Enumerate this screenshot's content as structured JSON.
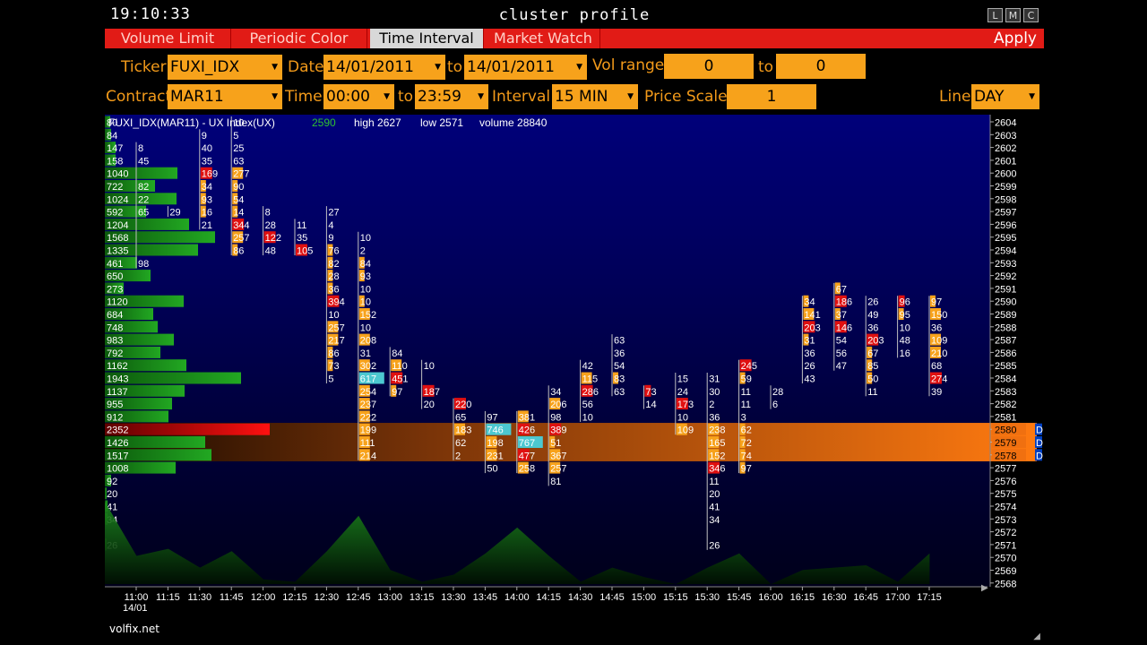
{
  "window": {
    "clock": "19:10:33",
    "title": "cluster profile",
    "buttons": [
      "L",
      "M",
      "C"
    ]
  },
  "tabs": [
    {
      "label": "Volume Limit"
    },
    {
      "label": "Periodic Color"
    },
    {
      "label": "Time Interval"
    },
    {
      "label": "Market Watch"
    }
  ],
  "apply_label": "Apply",
  "controls": {
    "ticker_label": "Ticker",
    "ticker_value": "FUXI_IDX",
    "date_label": "Date",
    "date_from": "14/01/2011",
    "to_label": "to",
    "date_to": "14/01/2011",
    "vol_range_label": "Vol range",
    "vol_from": "0",
    "vol_to_label": "to",
    "vol_to": "0",
    "contract_label": "Contract",
    "contract_value": "MAR11",
    "time_label": "Time",
    "time_from": "00:00",
    "time_to_label": "to",
    "time_to": "23:59",
    "interval_label": "Interval",
    "interval_value": "15 MIN",
    "price_scale_label": "Price Scale",
    "price_scale_value": "1",
    "line_label": "Line",
    "line_value": "DAY"
  },
  "header_info": {
    "name": "FUXI_IDX(MAR11) - UX Index(UX)",
    "last": "2590",
    "high": "high 2627",
    "low": "low 2571",
    "volume": "volume 28840"
  },
  "colors": {
    "bg_top": "#000080",
    "bg_bottom": "#000018",
    "accent_orange": "#f7a21b",
    "tab_red": "#e11b16",
    "profile_green": "#1c8a1c",
    "poc_red": "#e01010",
    "highlight_cyan": "#4cc8d0",
    "value_band": "#f07010"
  },
  "chart_data": {
    "type": "table",
    "price_axis": {
      "min": 2568,
      "max": 2604,
      "step": 1,
      "highlight": [
        2578,
        2579,
        2580
      ]
    },
    "time_labels": [
      "11:00",
      "11:15",
      "11:30",
      "11:45",
      "12:00",
      "12:15",
      "12:30",
      "12:45",
      "13:00",
      "13:15",
      "13:30",
      "13:45",
      "14:00",
      "14:15",
      "14:30",
      "14:45",
      "15:00",
      "15:15",
      "15:30",
      "15:45",
      "16:00",
      "16:15",
      "16:30",
      "16:45",
      "17:00",
      "17:15"
    ],
    "date_label": "14/01",
    "day_profile": [
      {
        "p": 2604,
        "v": "80"
      },
      {
        "p": 2603,
        "v": "84"
      },
      {
        "p": 2602,
        "v": "147"
      },
      {
        "p": 2601,
        "v": "158"
      },
      {
        "p": 2600,
        "v": "1040"
      },
      {
        "p": 2599,
        "v": "722"
      },
      {
        "p": 2598,
        "v": "1024"
      },
      {
        "p": 2597,
        "v": "592"
      },
      {
        "p": 2596,
        "v": "1204"
      },
      {
        "p": 2595,
        "v": "1568"
      },
      {
        "p": 2594,
        "v": "1335"
      },
      {
        "p": 2593,
        "v": "461"
      },
      {
        "p": 2592,
        "v": "650"
      },
      {
        "p": 2591,
        "v": "273"
      },
      {
        "p": 2590,
        "v": "1120"
      },
      {
        "p": 2589,
        "v": "684"
      },
      {
        "p": 2588,
        "v": "748"
      },
      {
        "p": 2587,
        "v": "983"
      },
      {
        "p": 2586,
        "v": "792"
      },
      {
        "p": 2585,
        "v": "1162"
      },
      {
        "p": 2584,
        "v": "1943"
      },
      {
        "p": 2583,
        "v": "1137"
      },
      {
        "p": 2582,
        "v": "955"
      },
      {
        "p": 2581,
        "v": "912"
      },
      {
        "p": 2580,
        "v": "2352"
      },
      {
        "p": 2579,
        "v": "1426"
      },
      {
        "p": 2578,
        "v": "1517"
      },
      {
        "p": 2577,
        "v": "1008"
      },
      {
        "p": 2576,
        "v": "92"
      },
      {
        "p": 2575,
        "v": "20"
      },
      {
        "p": 2574,
        "v": "41"
      },
      {
        "p": 2573,
        "v": "34"
      },
      {
        "p": 2571,
        "v": "26"
      }
    ],
    "clusters": [
      {
        "t": 0,
        "cells": [
          [
            2602,
            "8",
            ""
          ],
          [
            2601,
            "45",
            ""
          ],
          [
            2599,
            "82",
            ""
          ],
          [
            2598,
            "22",
            ""
          ],
          [
            2597,
            "65",
            ""
          ],
          [
            2596,
            "",
            ""
          ],
          [
            2593,
            "98",
            ""
          ]
        ]
      },
      {
        "t": 1,
        "cells": [
          [
            2597,
            "29",
            ""
          ]
        ]
      },
      {
        "t": 2,
        "cells": [
          [
            2603,
            "9",
            ""
          ],
          [
            2602,
            "40",
            ""
          ],
          [
            2601,
            "35",
            ""
          ],
          [
            2600,
            "169",
            "r"
          ],
          [
            2599,
            "34",
            "o"
          ],
          [
            2598,
            "93",
            "o"
          ],
          [
            2597,
            "16",
            "o"
          ],
          [
            2596,
            "21",
            ""
          ]
        ]
      },
      {
        "t": 3,
        "cells": [
          [
            2604,
            "10",
            ""
          ],
          [
            2603,
            "5",
            ""
          ],
          [
            2602,
            "25",
            ""
          ],
          [
            2601,
            "63",
            ""
          ],
          [
            2600,
            "277",
            "o"
          ],
          [
            2599,
            "90",
            "o"
          ],
          [
            2598,
            "54",
            "o"
          ],
          [
            2597,
            "14",
            "o"
          ],
          [
            2596,
            "344",
            "r"
          ],
          [
            2595,
            "257",
            "o"
          ],
          [
            2594,
            "86",
            "o"
          ]
        ]
      },
      {
        "t": 4,
        "cells": [
          [
            2597,
            "8",
            ""
          ],
          [
            2596,
            "28",
            ""
          ],
          [
            2595,
            "122",
            "r"
          ],
          [
            2594,
            "48",
            ""
          ]
        ]
      },
      {
        "t": 5,
        "cells": [
          [
            2596,
            "11",
            ""
          ],
          [
            2595,
            "35",
            ""
          ],
          [
            2594,
            "105",
            "r"
          ]
        ]
      },
      {
        "t": 6,
        "cells": [
          [
            2597,
            "27",
            ""
          ],
          [
            2596,
            "4",
            ""
          ],
          [
            2595,
            "9",
            ""
          ],
          [
            2594,
            "76",
            "o"
          ],
          [
            2593,
            "82",
            "o"
          ],
          [
            2592,
            "28",
            "o"
          ],
          [
            2591,
            "36",
            "o"
          ],
          [
            2590,
            "394",
            "r"
          ],
          [
            2589,
            "10",
            ""
          ],
          [
            2588,
            "257",
            "o"
          ],
          [
            2587,
            "217",
            "o"
          ],
          [
            2586,
            "86",
            "o"
          ],
          [
            2585,
            "73",
            "o"
          ],
          [
            2584,
            "5",
            ""
          ]
        ]
      },
      {
        "t": 7,
        "cells": [
          [
            2595,
            "10",
            ""
          ],
          [
            2594,
            "2",
            ""
          ],
          [
            2593,
            "84",
            "o"
          ],
          [
            2592,
            "93",
            "o"
          ],
          [
            2591,
            "10",
            ""
          ],
          [
            2590,
            "10",
            "o"
          ],
          [
            2589,
            "152",
            "o"
          ],
          [
            2588,
            "10",
            ""
          ],
          [
            2587,
            "208",
            "o"
          ],
          [
            2586,
            "31",
            ""
          ],
          [
            2585,
            "302",
            "o"
          ],
          [
            2584,
            "617",
            "c"
          ],
          [
            2583,
            "254",
            "o"
          ],
          [
            2582,
            "237",
            "o"
          ],
          [
            2581,
            "222",
            "o"
          ],
          [
            2580,
            "199",
            "o"
          ],
          [
            2579,
            "111",
            "o"
          ],
          [
            2578,
            "214",
            "o"
          ]
        ]
      },
      {
        "t": 8,
        "cells": [
          [
            2586,
            "84",
            ""
          ],
          [
            2585,
            "110",
            "o"
          ],
          [
            2584,
            "451",
            "r"
          ],
          [
            2583,
            "97",
            "o"
          ]
        ]
      },
      {
        "t": 9,
        "cells": [
          [
            2585,
            "10",
            ""
          ],
          [
            2583,
            "187",
            "r"
          ],
          [
            2582,
            "20",
            ""
          ]
        ]
      },
      {
        "t": 10,
        "cells": [
          [
            2582,
            "220",
            "r"
          ],
          [
            2581,
            "65",
            ""
          ],
          [
            2580,
            "183",
            "o"
          ],
          [
            2579,
            "62",
            ""
          ],
          [
            2578,
            "2",
            ""
          ]
        ]
      },
      {
        "t": 11,
        "cells": [
          [
            2581,
            "97",
            ""
          ],
          [
            2580,
            "746",
            "c"
          ],
          [
            2579,
            "198",
            "o"
          ],
          [
            2578,
            "231",
            "o"
          ],
          [
            2577,
            "50",
            ""
          ]
        ]
      },
      {
        "t": 12,
        "cells": [
          [
            2581,
            "381",
            "o"
          ],
          [
            2580,
            "426",
            "r"
          ],
          [
            2579,
            "767",
            "c"
          ],
          [
            2578,
            "477",
            "r"
          ],
          [
            2577,
            "258",
            "o"
          ]
        ]
      },
      {
        "t": 13,
        "cells": [
          [
            2583,
            "34",
            ""
          ],
          [
            2582,
            "206",
            "o"
          ],
          [
            2581,
            "98",
            ""
          ],
          [
            2580,
            "389",
            "r"
          ],
          [
            2579,
            "51",
            "o"
          ],
          [
            2578,
            "367",
            "o"
          ],
          [
            2577,
            "257",
            "o"
          ],
          [
            2576,
            "81",
            ""
          ]
        ]
      },
      {
        "t": 14,
        "cells": [
          [
            2585,
            "42",
            ""
          ],
          [
            2584,
            "115",
            "o"
          ],
          [
            2583,
            "286",
            "r"
          ],
          [
            2582,
            "56",
            ""
          ],
          [
            2581,
            "10",
            ""
          ]
        ]
      },
      {
        "t": 15,
        "cells": [
          [
            2587,
            "63",
            ""
          ],
          [
            2586,
            "36",
            ""
          ],
          [
            2585,
            "54",
            ""
          ],
          [
            2584,
            "83",
            "o"
          ],
          [
            2583,
            "63",
            ""
          ]
        ]
      },
      {
        "t": 16,
        "cells": [
          [
            2583,
            "73",
            "r"
          ],
          [
            2582,
            "14",
            ""
          ]
        ]
      },
      {
        "t": 17,
        "cells": [
          [
            2584,
            "15",
            ""
          ],
          [
            2583,
            "24",
            ""
          ],
          [
            2582,
            "173",
            "r"
          ],
          [
            2581,
            "10",
            ""
          ],
          [
            2580,
            "109",
            "o"
          ]
        ]
      },
      {
        "t": 18,
        "cells": [
          [
            2584,
            "31",
            ""
          ],
          [
            2583,
            "30",
            ""
          ],
          [
            2582,
            "2",
            ""
          ],
          [
            2581,
            "36",
            ""
          ],
          [
            2580,
            "238",
            "o"
          ],
          [
            2579,
            "165",
            "o"
          ],
          [
            2578,
            "152",
            "o"
          ],
          [
            2577,
            "346",
            "r"
          ],
          [
            2576,
            "11",
            ""
          ],
          [
            2575,
            "20",
            ""
          ],
          [
            2574,
            "41",
            ""
          ],
          [
            2573,
            "34",
            ""
          ],
          [
            2571,
            "26",
            ""
          ]
        ]
      },
      {
        "t": 19,
        "cells": [
          [
            2585,
            "245",
            "r"
          ],
          [
            2584,
            "59",
            "o"
          ],
          [
            2583,
            "11",
            ""
          ],
          [
            2582,
            "11",
            ""
          ],
          [
            2581,
            "3",
            ""
          ],
          [
            2580,
            "62",
            "o"
          ],
          [
            2579,
            "72",
            "o"
          ],
          [
            2578,
            "74",
            "o"
          ],
          [
            2577,
            "97",
            "o"
          ]
        ]
      },
      {
        "t": 20,
        "cells": [
          [
            2583,
            "28",
            ""
          ],
          [
            2582,
            "6",
            ""
          ]
        ]
      },
      {
        "t": 21,
        "cells": [
          [
            2590,
            "34",
            "o"
          ],
          [
            2589,
            "141",
            "o"
          ],
          [
            2588,
            "203",
            "r"
          ],
          [
            2587,
            "31",
            "o"
          ],
          [
            2586,
            "36",
            ""
          ],
          [
            2585,
            "26",
            ""
          ],
          [
            2584,
            "43",
            ""
          ]
        ]
      },
      {
        "t": 22,
        "cells": [
          [
            2591,
            "67",
            "o"
          ],
          [
            2590,
            "186",
            "r"
          ],
          [
            2589,
            "37",
            "o"
          ],
          [
            2588,
            "146",
            "r"
          ],
          [
            2587,
            "54",
            ""
          ],
          [
            2586,
            "56",
            ""
          ],
          [
            2585,
            "47",
            ""
          ]
        ]
      },
      {
        "t": 23,
        "cells": [
          [
            2590,
            "26",
            ""
          ],
          [
            2589,
            "49",
            ""
          ],
          [
            2588,
            "36",
            ""
          ],
          [
            2587,
            "203",
            "r"
          ],
          [
            2586,
            "67",
            "o"
          ],
          [
            2585,
            "85",
            "o"
          ],
          [
            2584,
            "50",
            "o"
          ],
          [
            2583,
            "11",
            ""
          ]
        ]
      },
      {
        "t": 24,
        "cells": [
          [
            2590,
            "96",
            "r"
          ],
          [
            2589,
            "95",
            "o"
          ],
          [
            2588,
            "10",
            ""
          ],
          [
            2587,
            "48",
            ""
          ],
          [
            2586,
            "16",
            ""
          ]
        ]
      },
      {
        "t": 25,
        "cells": [
          [
            2590,
            "97",
            "o"
          ],
          [
            2589,
            "150",
            "o"
          ],
          [
            2588,
            "36",
            ""
          ],
          [
            2587,
            "109",
            "o"
          ],
          [
            2586,
            "210",
            "o"
          ],
          [
            2585,
            "68",
            ""
          ],
          [
            2584,
            "274",
            "r"
          ],
          [
            2583,
            "39",
            ""
          ]
        ]
      }
    ],
    "volume_series": [
      35,
      12,
      15,
      7,
      14,
      2,
      1,
      14,
      29,
      6,
      1,
      4,
      13,
      24,
      12,
      1,
      7,
      3,
      0,
      7,
      13,
      0,
      6,
      7,
      8,
      1,
      13
    ]
  }
}
